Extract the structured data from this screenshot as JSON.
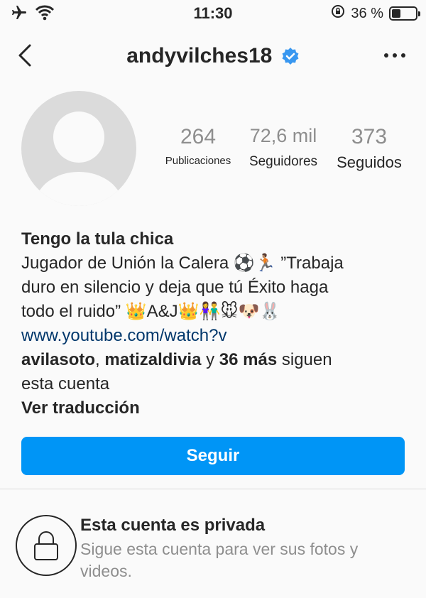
{
  "status_bar": {
    "time": "11:30",
    "battery_text": "36 %",
    "battery_level": 0.36,
    "icons": [
      "airplane-icon",
      "wifi-icon",
      "orientation-lock-icon",
      "battery-icon"
    ]
  },
  "header": {
    "username": "andyvilches18",
    "verified": true,
    "icons": [
      "back-chevron-icon",
      "verified-badge-icon",
      "more-options-icon"
    ]
  },
  "stats": [
    {
      "value": "264",
      "label": "Publicaciones"
    },
    {
      "value": "72,6 mil",
      "label": "Seguidores"
    },
    {
      "value": "373",
      "label": "Seguidos"
    }
  ],
  "bio": {
    "name": "Tengo la tula chica",
    "line1": "Jugador de Unión la Calera ⚽🏃🏽 ”Trabaja",
    "line2": "duro en silencio y deja que tú Éxito haga",
    "line3": "todo el ruido” 👑A&J👑👫🐭🐶🐰",
    "link": "www.youtube.com/watch?v",
    "followed_by": {
      "user1": "avilasoto",
      "sep": ", ",
      "user2": "matizaldivia",
      "and": " y ",
      "more": "36 más",
      "rest": " siguen",
      "line2": "esta cuenta"
    },
    "translate": "Ver traducción"
  },
  "follow_button": "Seguir",
  "private": {
    "title": "Esta cuenta es privada",
    "subtitle": "Sigue esta cuenta para ver sus fotos y videos."
  },
  "colors": {
    "accent": "#0095f6",
    "verified": "#3897f0",
    "link": "#00376b",
    "muted": "#8e8e8e"
  }
}
